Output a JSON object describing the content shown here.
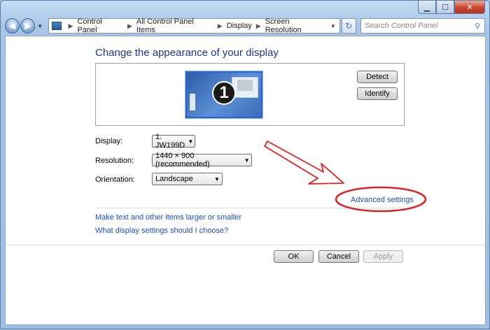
{
  "window": {
    "caption_buttons": [
      "minimize-icon",
      "maximize-icon",
      "close-icon"
    ]
  },
  "nav": {
    "breadcrumb": [
      "Control Panel",
      "All Control Panel Items",
      "Display",
      "Screen Resolution"
    ],
    "search_placeholder": "Search Control Panel"
  },
  "main": {
    "heading": "Change the appearance of your display",
    "monitor_number": "1",
    "buttons": {
      "detect": "Detect",
      "identify": "Identify"
    },
    "fields": {
      "display": {
        "label": "Display:",
        "value": "1. JW199D"
      },
      "resolution": {
        "label": "Resolution:",
        "value": "1440 × 900 (recommended)"
      },
      "orientation": {
        "label": "Orientation:",
        "value": "Landscape"
      }
    },
    "advanced_link": "Advanced settings",
    "links": {
      "text_size": "Make text and other items larger or smaller",
      "help": "What display settings should I choose?"
    }
  },
  "footer": {
    "ok": "OK",
    "cancel": "Cancel",
    "apply": "Apply"
  },
  "colors": {
    "annotation": "#e02020",
    "link": "#1a4fb5",
    "heading": "#1e3287"
  }
}
